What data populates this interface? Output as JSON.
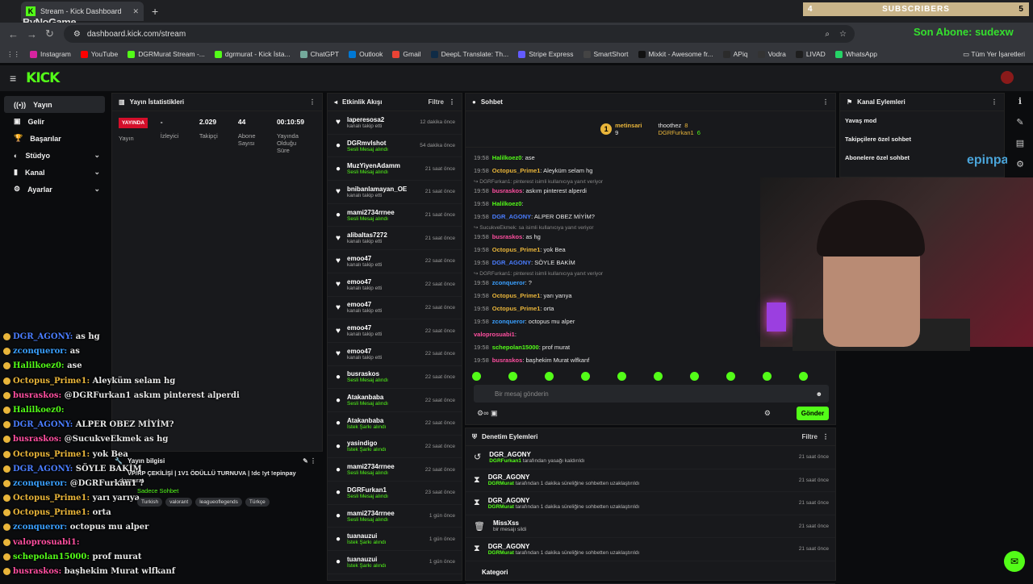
{
  "browser": {
    "tab_title": "Stream - Kick Dashboard",
    "url": "dashboard.kick.com/stream",
    "bookmarks": [
      "Instagram",
      "YouTube",
      "DGRMurat Stream -...",
      "dgrmurat - Kick İsta...",
      "ChatGPT",
      "Outlook",
      "Gmail",
      "DeepL Translate: Th...",
      "Stripe Express",
      "SmartShort",
      "Mixkit - Awesome fr...",
      "APiq",
      "Vodra",
      "LIVAD",
      "WhatsApp"
    ],
    "bookmarks_all": "Tüm Yer İşaretleri",
    "bookmark_colors": [
      "#d6249f",
      "#ff0000",
      "#53fc18",
      "#53fc18",
      "#74aa9c",
      "#0078d4",
      "#ea4335",
      "#0f2b46",
      "#635bff",
      "#444",
      "#111",
      "#2b2b2b",
      "#333",
      "#1e1e1e",
      "#25d366"
    ]
  },
  "overlay": {
    "subscribers_left": "4",
    "subscribers_label": "SUBSCRIBERS",
    "subscribers_right": "5",
    "watermark": "ByNoGame",
    "last_sub": "Son Abone: sudexw",
    "sponsor": "epinpay"
  },
  "nav": {
    "logo": "KICK",
    "items": [
      {
        "label": "Yayın"
      },
      {
        "label": "Gelir"
      },
      {
        "label": "Başarılar"
      },
      {
        "label": "Stüdyo"
      },
      {
        "label": "Kanal"
      },
      {
        "label": "Ayarlar"
      }
    ]
  },
  "stats": {
    "title": "Yayın İstatistikleri",
    "live": "YAYINDA",
    "live_label": "Yayın",
    "viewers": "-",
    "viewers_label": "İzleyici",
    "followers": "2.029",
    "followers_label": "Takipçi",
    "subs": "44",
    "subs_label": "Abone Sayısı",
    "duration": "00:10:59",
    "duration_label": "Yayında Olduğu Süre"
  },
  "activity": {
    "title": "Etkinlik Akışı",
    "filter": "Filtre",
    "items": [
      {
        "icon": "♥",
        "name": "laperesosa2",
        "sub": "kanalı takip etti",
        "time": "12 dakika önce",
        "g": false
      },
      {
        "icon": "●",
        "name": "DGRmvlshot",
        "sub": "Sesli Mesaj alındı",
        "time": "54 dakika önce",
        "g": true
      },
      {
        "icon": "●",
        "name": "MuzYiyenAdamm",
        "sub": "Sesli Mesaj alındı",
        "time": "21 saat önce",
        "g": true
      },
      {
        "icon": "♥",
        "name": "bnibanlamayan_OE",
        "sub": "kanalı takip etti",
        "time": "21 saat önce",
        "g": false
      },
      {
        "icon": "●",
        "name": "mami2734rrnee",
        "sub": "Sesli Mesaj alındı",
        "time": "21 saat önce",
        "g": true
      },
      {
        "icon": "♥",
        "name": "alibaltas7272",
        "sub": "kanalı takip etti",
        "time": "21 saat önce",
        "g": false
      },
      {
        "icon": "♥",
        "name": "emoo47",
        "sub": "kanalı takip etti",
        "time": "22 saat önce",
        "g": false
      },
      {
        "icon": "♥",
        "name": "emoo47",
        "sub": "kanalı takip etti",
        "time": "22 saat önce",
        "g": false
      },
      {
        "icon": "♥",
        "name": "emoo47",
        "sub": "kanalı takip etti",
        "time": "22 saat önce",
        "g": false
      },
      {
        "icon": "♥",
        "name": "emoo47",
        "sub": "kanalı takip etti",
        "time": "22 saat önce",
        "g": false
      },
      {
        "icon": "♥",
        "name": "emoo47",
        "sub": "kanalı takip etti",
        "time": "22 saat önce",
        "g": false
      },
      {
        "icon": "●",
        "name": "busraskos",
        "sub": "Sesli Mesaj alındı",
        "time": "22 saat önce",
        "g": true
      },
      {
        "icon": "●",
        "name": "Atakanbaba",
        "sub": "Sesli Mesaj alındı",
        "time": "22 saat önce",
        "g": true
      },
      {
        "icon": "●",
        "name": "Atakanbaba",
        "sub": "İstek Şarkı alındı",
        "time": "22 saat önce",
        "g": true
      },
      {
        "icon": "●",
        "name": "yasindigo",
        "sub": "İstek Şarkı alındı",
        "time": "22 saat önce",
        "g": true
      },
      {
        "icon": "●",
        "name": "mami2734rrnee",
        "sub": "Sesli Mesaj alındı",
        "time": "22 saat önce",
        "g": true
      },
      {
        "icon": "●",
        "name": "DGRFurkan1",
        "sub": "Sesli Mesaj alındı",
        "time": "23 saat önce",
        "g": true
      },
      {
        "icon": "●",
        "name": "mami2734rrnee",
        "sub": "Sesli Mesaj alındı",
        "time": "1 gün önce",
        "g": true
      },
      {
        "icon": "●",
        "name": "tuanauzui",
        "sub": "İstek Şarkı alındı",
        "time": "1 gün önce",
        "g": true
      },
      {
        "icon": "●",
        "name": "tuanauzui",
        "sub": "İstek Şarkı alındı",
        "time": "1 gün önce",
        "g": true
      }
    ]
  },
  "chat": {
    "title": "Sohbet",
    "pinned": [
      {
        "name": "metinsari",
        "count": "9"
      },
      {
        "name": "thoothez",
        "count": "8"
      },
      {
        "name": "DGRFurkan1",
        "count": "6"
      }
    ],
    "messages": [
      {
        "t": "19:58",
        "u": "Halilkoez0",
        "c": "#53fc18",
        "m": ": ase",
        "r": ""
      },
      {
        "t": "19:58",
        "u": "Octopus_Prime1",
        "c": "#e9b53a",
        "m": ": Aleyküm selam hg",
        "r": ""
      },
      {
        "t": "19:58",
        "u": "busraskos",
        "c": "#ff4fa0",
        "m": ": askım pinterest alperdi",
        "r": "DGRFurkan1: pinterest isimli kullanıcıya yanıt veriyor"
      },
      {
        "t": "19:58",
        "u": "Halilkoez0",
        "c": "#53fc18",
        "m": ":",
        "r": ""
      },
      {
        "t": "19:58",
        "u": "DGR_AGONY",
        "c": "#4a7dff",
        "m": ": ALPER OBEZ MİYİM?",
        "r": ""
      },
      {
        "t": "19:58",
        "u": "busraskos",
        "c": "#ff4fa0",
        "m": ": as hg",
        "r": "SucukveEkmek: sa isimli kullanıcıya yanıt veriyor"
      },
      {
        "t": "19:58",
        "u": "Octopus_Prime1",
        "c": "#e9b53a",
        "m": ": yok Bea",
        "r": ""
      },
      {
        "t": "19:58",
        "u": "DGR_AGONY",
        "c": "#4a7dff",
        "m": ": SÖYLE BAKİM",
        "r": ""
      },
      {
        "t": "19:58",
        "u": "zconqueror",
        "c": "#3aa0ff",
        "m": ": ?",
        "r": "DGRFurkan1: pinterest isimli kullanıcıya yanıt veriyor"
      },
      {
        "t": "19:58",
        "u": "Octopus_Prime1",
        "c": "#e9b53a",
        "m": ": yarı yarıya",
        "r": ""
      },
      {
        "t": "19:58",
        "u": "Octopus_Prime1",
        "c": "#e9b53a",
        "m": ": orta",
        "r": ""
      },
      {
        "t": "19:58",
        "u": "zconqueror",
        "c": "#3aa0ff",
        "m": ": octopus mu alper",
        "r": ""
      },
      {
        "t": "",
        "u": "valoprosuabi1",
        "c": "#ff4fa0",
        "m": ":",
        "r": ""
      },
      {
        "t": "19:58",
        "u": "schepolan15000",
        "c": "#53fc18",
        "m": ": prof murat",
        "r": ""
      },
      {
        "t": "19:58",
        "u": "busraskos",
        "c": "#ff4fa0",
        "m": ": başhekim Murat wlfkanf",
        "r": ""
      }
    ],
    "input_placeholder": "Bir mesaj gönderin",
    "send": "Gönder"
  },
  "channel_actions": {
    "title": "Kanal Eylemleri",
    "items": [
      "Yavaş mod",
      "Takipçilere özel sohbet",
      "Abonelere özel sohbet"
    ]
  },
  "moderation": {
    "title": "Denetim Eylemleri",
    "filter": "Filtre",
    "items": [
      {
        "icon": "↺",
        "name": "DGR_AGONY",
        "by": "DGRFurkan1",
        "text": "tarafından yasağı kaldırıldı",
        "time": "21 saat önce"
      },
      {
        "icon": "⧗",
        "name": "DGR_AGONY",
        "by": "DGRMurat",
        "text": "tarafından 1 dakika süreliğine sohbetten uzaklaştırıldı",
        "time": "21 saat önce"
      },
      {
        "icon": "⧗",
        "name": "DGR_AGONY",
        "by": "DGRMurat",
        "text": "tarafından 1 dakika süreliğine sohbetten uzaklaştırıldı",
        "time": "21 saat önce"
      },
      {
        "icon": "🗑",
        "name": "MissXss",
        "by": "",
        "text": "bir mesajı sildi",
        "time": "21 saat önce"
      },
      {
        "icon": "⧗",
        "name": "DGR_AGONY",
        "by": "DGRMurat",
        "text": "tarafından 1 dakika süreliğine sohbetten uzaklaştırıldı",
        "time": "21 saat önce"
      },
      {
        "icon": "",
        "name": "Kategori",
        "by": "",
        "text": "",
        "time": ""
      }
    ]
  },
  "stream_info": {
    "title": "Yayın bilgisi",
    "stream_title": "VP/RP ÇEKİLİŞİ | 1V1 ÖDÜLLÜ TURNUVA | !dc !yt !epinpay",
    "channel": "dgrmurat",
    "chat_mode": "Sadece Sohbet",
    "tags": [
      "Turkish",
      "valorant",
      "leagueoflegends",
      "Türkçe"
    ]
  },
  "overlay_chat": [
    {
      "u": "DGR_AGONY",
      "c": "#4a7dff",
      "m": "as hg"
    },
    {
      "u": "zconqueror",
      "c": "#3aa0ff",
      "m": "as"
    },
    {
      "u": "Halilkoez0",
      "c": "#53fc18",
      "m": "ase"
    },
    {
      "u": "Octopus_Prime1",
      "c": "#e9b53a",
      "m": "Aleyküm selam hg"
    },
    {
      "u": "busraskos",
      "c": "#ff4fa0",
      "m": "@DGRFurkan1 askım pinterest alperdi"
    },
    {
      "u": "Halilkoez0",
      "c": "#53fc18",
      "m": ""
    },
    {
      "u": "DGR_AGONY",
      "c": "#4a7dff",
      "m": "ALPER OBEZ MİYİM?"
    },
    {
      "u": "busraskos",
      "c": "#ff4fa0",
      "m": "@SucukveEkmek as hg"
    },
    {
      "u": "Octopus_Prime1",
      "c": "#e9b53a",
      "m": "yok Bea"
    },
    {
      "u": "DGR_AGONY",
      "c": "#4a7dff",
      "m": "SÖYLE BAKİM"
    },
    {
      "u": "zconqueror",
      "c": "#3aa0ff",
      "m": "@DGRFurkan1 ?"
    },
    {
      "u": "Octopus_Prime1",
      "c": "#e9b53a",
      "m": "yarı yarıya"
    },
    {
      "u": "Octopus_Prime1",
      "c": "#e9b53a",
      "m": "orta"
    },
    {
      "u": "zconqueror",
      "c": "#3aa0ff",
      "m": "octopus mu alper"
    },
    {
      "u": "valoprosuabi1",
      "c": "#ff4fa0",
      "m": ""
    },
    {
      "u": "schepolan15000",
      "c": "#53fc18",
      "m": "prof murat"
    },
    {
      "u": "busraskos",
      "c": "#ff4fa0",
      "m": "başhekim Murat wlfkanf"
    }
  ]
}
